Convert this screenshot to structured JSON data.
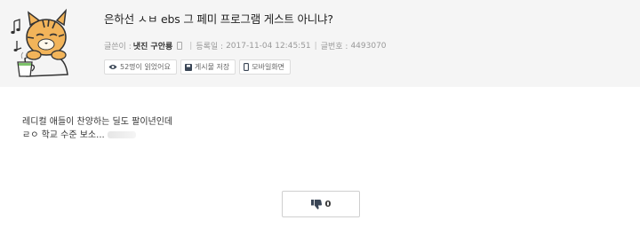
{
  "post": {
    "title": "은하선 ㅅㅂ ebs 그 페미 프로그램 게스트 아니냐?",
    "meta": {
      "author_label": "글쓴이 :",
      "author": "냇진 구안룡",
      "date_label": "등록일 :",
      "date": "2017-11-04 12:45:51",
      "id_label": "글번호 :",
      "id": "4493070"
    },
    "actions": [
      {
        "label": "52명이 읽었어요",
        "icon": "eye-icon"
      },
      {
        "label": "게시물 저장",
        "icon": "save-icon"
      },
      {
        "label": "모바일화면",
        "icon": "mobile-icon"
      }
    ],
    "body_lines": [
      "레디컬 애들이 찬양하는 딜도 팔이년인데",
      "ㄹㅇ 학교 수준 보소..."
    ]
  },
  "vote": {
    "dislike_icon": "thumbs-down-icon",
    "dislike_count": "0"
  },
  "colors": {
    "header_bg": "#f5f5f5",
    "icon_dark": "#3a4656"
  }
}
